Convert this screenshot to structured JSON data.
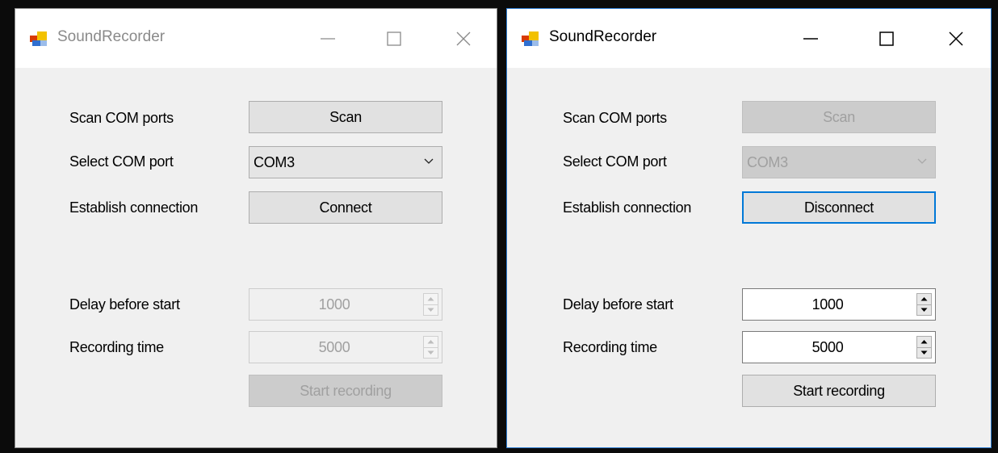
{
  "windows": [
    {
      "title": "SoundRecorder",
      "state": "disconnected",
      "scan_label": "Scan COM ports",
      "scan_button": "Scan",
      "select_label": "Select COM port",
      "port_value": "COM3",
      "connect_label": "Establish connection",
      "connect_button": "Connect",
      "delay_label": "Delay before start",
      "delay_value": "1000",
      "time_label": "Recording time",
      "time_value": "5000",
      "record_button": "Start recording"
    },
    {
      "title": "SoundRecorder",
      "state": "connected",
      "scan_label": "Scan COM ports",
      "scan_button": "Scan",
      "select_label": "Select COM port",
      "port_value": "COM3",
      "connect_label": "Establish connection",
      "connect_button": "Disconnect",
      "delay_label": "Delay before start",
      "delay_value": "1000",
      "time_label": "Recording time",
      "time_value": "5000",
      "record_button": "Start recording"
    }
  ],
  "icons": {
    "app": "app-window-icon",
    "minimize": "minimize-icon",
    "maximize": "maximize-icon",
    "close": "close-icon",
    "dropdown": "chevron-down-icon",
    "spin_up": "spin-up-icon",
    "spin_down": "spin-down-icon"
  },
  "colors": {
    "focus_border": "#0078d7",
    "active_window_border": "#2b7bd1",
    "disabled_text": "#a0a0a0"
  }
}
